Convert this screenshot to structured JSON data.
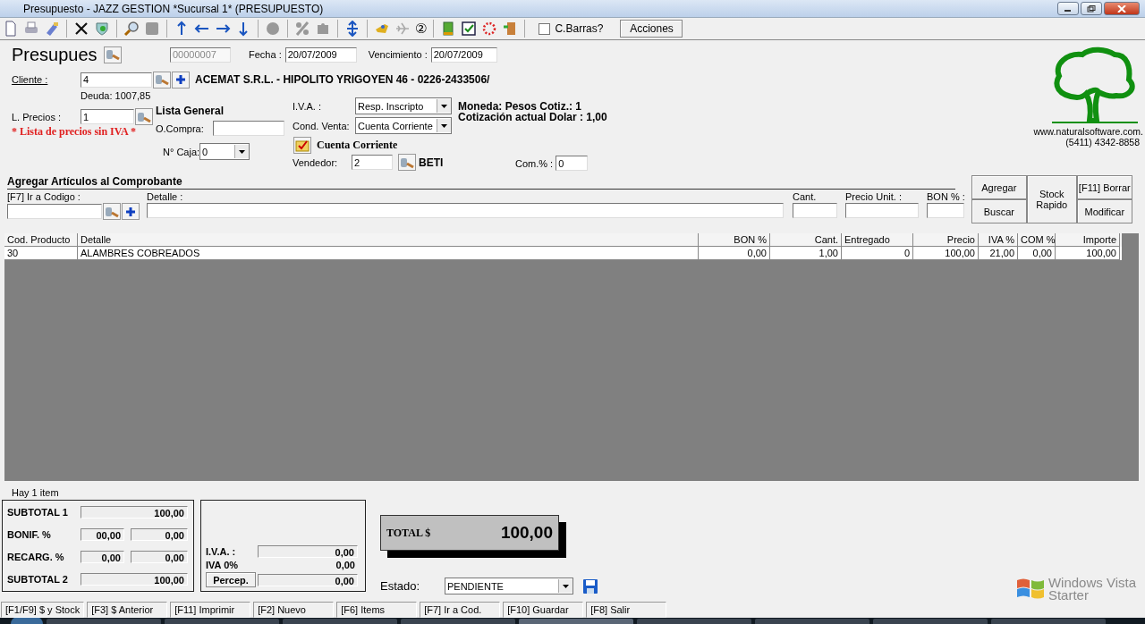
{
  "window": {
    "title": "Presupuesto - JAZZ GESTION *Sucursal 1* (PRESUPUESTO)"
  },
  "toolbar": {
    "number_icon": "②",
    "barcode": {
      "label": "C.Barras?",
      "checked": false
    },
    "actions_button": "Acciones"
  },
  "header": {
    "doc_title": "Presupues",
    "number": "00000007",
    "date_label": "Fecha :",
    "date": "20/07/2009",
    "due_label": "Vencimiento :",
    "due": "20/07/2009"
  },
  "client": {
    "label": "Cliente :",
    "value": "4",
    "name": "ACEMAT S.R.L. - HIPOLITO YRIGOYEN 46 - 0226-2433506/",
    "debt": "Deuda: 1007,85"
  },
  "price_list": {
    "label": "L. Precios :",
    "value": "1",
    "name": "Lista General",
    "warning": "* Lista de precios sin IVA *"
  },
  "purchase_order": {
    "label": "O.Compra:"
  },
  "cash_box": {
    "label": "N° Caja:",
    "value": "0"
  },
  "iva": {
    "label": "I.V.A. :",
    "value": "Resp. Inscripto"
  },
  "sale_condition": {
    "label": "Cond. Venta:",
    "value": "Cuenta Corriente",
    "note": "Cuenta Corriente"
  },
  "seller": {
    "label": "Vendedor:",
    "value": "2",
    "name": "BETI"
  },
  "commission": {
    "label": "Com.% :",
    "value": "0"
  },
  "currency": {
    "line1": "Moneda: Pesos Cotiz.: 1",
    "line2": "Cotización actual Dolar : 1,00"
  },
  "logo": {
    "url": "www.naturalsoftware.com.",
    "phone": "(5411) 4342-8858"
  },
  "articles": {
    "title": "Agregar Artículos al Comprobante",
    "code_label": "[F7] Ir a Codigo :",
    "detail_label": "Detalle :",
    "qty_label": "Cant.",
    "price_label": "Precio Unit. :",
    "bon_label": "BON % :",
    "buttons": {
      "add": "Agregar",
      "search": "Buscar",
      "stock": "Stock Rapido",
      "delete": "[F11] Borrar",
      "modify": "Modificar"
    }
  },
  "table": {
    "columns": [
      "Cod. Producto",
      "Detalle",
      "BON %",
      "Cant.",
      "Entregado",
      "Precio",
      "IVA %",
      "COM %",
      "Importe"
    ],
    "rows": [
      [
        "30",
        "ALAMBRES COBREADOS",
        "0,00",
        "1,00",
        "0",
        "100,00",
        "21,00",
        "0,00",
        "100,00"
      ]
    ]
  },
  "item_count": "Hay 1 item",
  "totals": {
    "subtotal1_label": "SUBTOTAL 1",
    "subtotal1": "100,00",
    "bonif_label": "BONIF. %",
    "bonif_pct": "00,00",
    "bonif": "0,00",
    "recarg_label": "RECARG. %",
    "recarg_pct": "0,00",
    "recarg": "0,00",
    "subtotal2_label": "SUBTOTAL 2",
    "subtotal2": "100,00"
  },
  "taxes": {
    "iva_label": "I.V.A. :",
    "iva": "0,00",
    "iva0_label": "IVA 0%",
    "iva0": "0,00",
    "percep_button": "Percep.",
    "percep": "0,00"
  },
  "total": {
    "label": "TOTAL $",
    "value": "100,00"
  },
  "status": {
    "label": "Estado:",
    "value": "PENDIENTE"
  },
  "status_bar": [
    "[F1/F9] $ y Stock",
    "[F3] $ Anterior",
    "[F11] Imprimir",
    "[F2] Nuevo",
    "[F6] Items",
    "[F7] Ir a Cod.",
    "[F10] Guardar",
    "[F8] Salir"
  ],
  "os_watermark": {
    "line1": "Windows Vista",
    "line2": "Starter"
  }
}
